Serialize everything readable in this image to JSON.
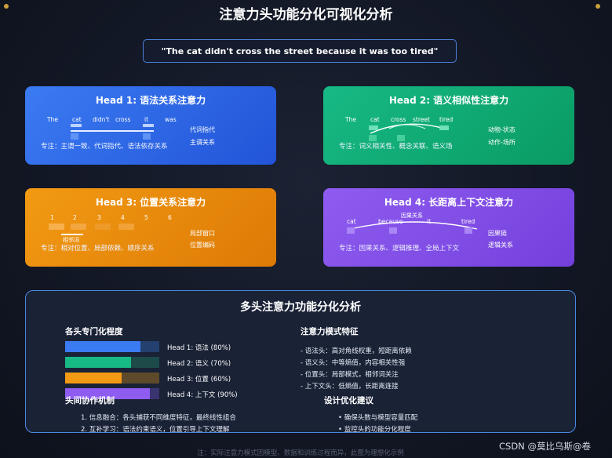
{
  "title": "注意力头功能分化可视化分析",
  "sentence": "\"The cat didn't cross the street because it was too tired\"",
  "heads": [
    {
      "title": "Head 1: 语法关系注意力",
      "tokens": [
        "The",
        "cat",
        "didn't",
        "cross",
        "it",
        "was"
      ],
      "notes": [
        "代词指代",
        "主谓关系"
      ],
      "focus": "专注：主谓一致、代词指代、语法依存关系"
    },
    {
      "title": "Head 2: 语义相似性注意力",
      "tokens": [
        "The",
        "cat",
        "cross",
        "street",
        "tired"
      ],
      "notes": [
        "动物-状态",
        "动作-场所"
      ],
      "focus": "专注：词义相关性、概念关联、语义场"
    },
    {
      "title": "Head 3: 位置关系注意力",
      "tokens": [
        "1",
        "2",
        "3",
        "4",
        "5",
        "6"
      ],
      "adjacent": "相邻词",
      "notes": [
        "局部窗口",
        "位置编码"
      ],
      "focus": "专注：相对位置、局部依赖、顺序关系"
    },
    {
      "title": "Head 4: 长距离上下文注意力",
      "tokens": [
        "cat",
        "because",
        "it",
        "tired"
      ],
      "arc_label": "因果关系",
      "notes": [
        "因果链",
        "逻辑关系"
      ],
      "focus": "专注：因果关系、逻辑推理、全局上下文"
    }
  ],
  "panel": {
    "title": "多头注意力功能分化分析",
    "specialization": {
      "heading": "各头专门化程度",
      "bars": [
        {
          "label": "Head 1: 语法 (80%)",
          "value": 0.8,
          "color": "#3b7bf2",
          "track": "#23406f"
        },
        {
          "label": "Head 2: 语义 (70%)",
          "value": 0.7,
          "color": "#17b985",
          "track": "#1c4b4a"
        },
        {
          "label": "Head 3: 位置 (60%)",
          "value": 0.6,
          "color": "#f29a13",
          "track": "#5e4a2a"
        },
        {
          "label": "Head 4: 上下文 (90%)",
          "value": 0.9,
          "color": "#8e5cf0",
          "track": "#3a3470"
        }
      ]
    },
    "patterns": {
      "heading": "注意力模式特征",
      "items": [
        "- 语法头：高对角线权重，短距离依赖",
        "- 语义头：中等熵值，内容相关性强",
        "- 位置头：局部模式，相邻词关注",
        "- 上下文头：低熵值，长距离连接"
      ]
    },
    "cooperation": {
      "heading": "头间协作机制",
      "items": [
        "1. 信息融合：各头捕获不同维度特征，最终线性组合",
        "2. 互补学习：语法约束语义，位置引导上下文理解"
      ]
    },
    "optimization": {
      "heading": "设计优化建议",
      "items": [
        "• 确保头数与模型容量匹配",
        "• 监控头的功能分化程度"
      ]
    }
  },
  "footer": "注：实际注意力模式因模型、数据和训练过程而异，此图为理想化示例",
  "watermark": "CSDN @莫比乌斯@卷"
}
